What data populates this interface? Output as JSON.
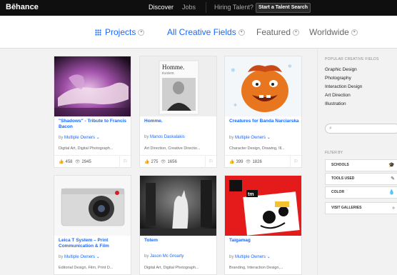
{
  "topbar": {
    "logo": "Bēhance",
    "nav": [
      "Discover",
      "Jobs",
      "Hiring Talent?"
    ],
    "talent_button": "Start a Talent Search"
  },
  "filters": {
    "projects": "Projects",
    "fields": "All Creative Fields",
    "featured": "Featured",
    "worldwide": "Worldwide"
  },
  "cards": [
    {
      "title": "\"Shadows\" - Tribute to Francis Bacon",
      "by": "by",
      "owner": "Multiple Owners",
      "fields": "Digital Art, Digital Photograph...",
      "appreciations": "458",
      "views": "2945"
    },
    {
      "title": "Homme.",
      "by": "by",
      "owner": "Manos Daskalakis",
      "fields": "Art Direction, Creative Directio...",
      "appreciations": "275",
      "views": "1656"
    },
    {
      "title": "Creatures for Banda Narciarska",
      "by": "by",
      "owner": "Multiple Owners",
      "fields": "Character Design, Drawing, Ill...",
      "appreciations": "399",
      "views": "1826"
    },
    {
      "title": "Leica T System – Print Communication & Film",
      "by": "by",
      "owner": "Multiple Owners",
      "fields": "Editorial Design, Film, Print D..."
    },
    {
      "title": "Totem",
      "by": "by",
      "owner": "Jason Mc Groarty",
      "fields": "Digital Art, Digital Photograph..."
    },
    {
      "title": "Taigamag",
      "by": "by",
      "owner": "Multiple Owners",
      "fields": "Branding, Interaction Design,..."
    }
  ],
  "thumb_text": {
    "homme_title": "Homme.",
    "homme_sub": "ÉGOÏSTE.",
    "taiga_tm": "tm"
  },
  "sidebar": {
    "popular_heading": "POPULAR CREATIVE FIELDS",
    "popular": [
      "Graphic Design",
      "Photography",
      "Interaction Design",
      "Art Direction",
      "Illustration"
    ],
    "filter_by": "FILTER BY",
    "schools": "SCHOOLS",
    "tools_used": "TOOLS USED",
    "color": "COLOR",
    "visit_galleries": "VISIT GALLERIES"
  },
  "colors": {
    "accent": "#1769ff",
    "topbar": "#0f0f0f"
  },
  "icons": [
    "grid-icon",
    "chevron-down-icon",
    "eye-icon",
    "thumbs-up-icon",
    "search-icon",
    "flag-icon"
  ]
}
